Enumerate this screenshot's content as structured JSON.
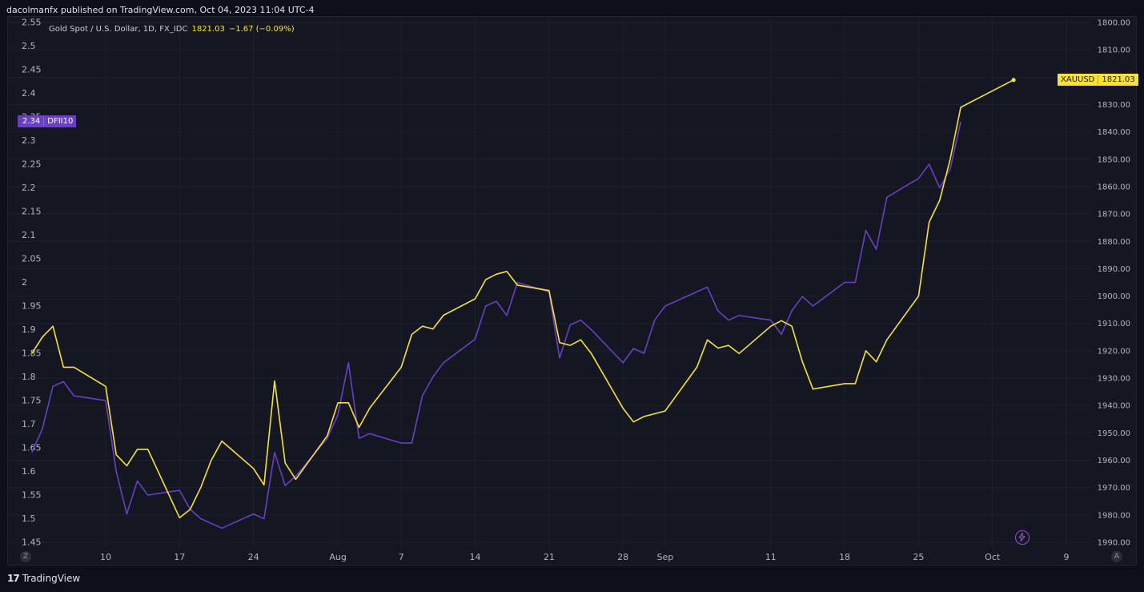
{
  "header": {
    "publisher_text": "dacolmanfx published on TradingView.com, Oct 04, 2023 11:04 UTC-4"
  },
  "legend": {
    "symbol_text": "Gold Spot / U.S. Dollar, 1D, FX_IDC",
    "price": "1821.03",
    "change": "−1.67 (−0.09%)"
  },
  "tags": {
    "left": {
      "value": "2.34",
      "name": "DFII10"
    },
    "right": {
      "name": "XAUUSD",
      "value": "1821.03"
    }
  },
  "footer": {
    "logo_text": "TradingView"
  },
  "buttons": {
    "zoom_left_label": "Z",
    "auto_scale_label": "A"
  },
  "colors": {
    "background": "#0b0f17",
    "panel": "#141722",
    "grid": "#1c2030",
    "axis_text": "#b2b5be",
    "xauusd": "#f7e13b",
    "dfii10": "#6a3fc2"
  },
  "chart_data": {
    "type": "line",
    "grid": true,
    "legend_placement": "top-left",
    "x_ticks": [
      "10",
      "17",
      "24",
      "Aug",
      "7",
      "14",
      "21",
      "28",
      "Sep",
      "11",
      "18",
      "25",
      "Oct",
      "9"
    ],
    "left_axis": {
      "ticks": [
        "2.55",
        "2.5",
        "2.45",
        "2.4",
        "2.35",
        "2.3",
        "2.25",
        "2.2",
        "2.15",
        "2.1",
        "2.05",
        "2",
        "1.95",
        "1.9",
        "1.85",
        "1.8",
        "1.75",
        "1.7",
        "1.65",
        "1.6",
        "1.55",
        "1.5",
        "1.45"
      ],
      "range": [
        1.45,
        2.55
      ]
    },
    "right_axis": {
      "inverted": true,
      "ticks": [
        "1800.00",
        "1810.00",
        "1820.00",
        "1830.00",
        "1840.00",
        "1850.00",
        "1860.00",
        "1870.00",
        "1880.00",
        "1890.00",
        "1900.00",
        "1910.00",
        "1920.00",
        "1930.00",
        "1940.00",
        "1950.00",
        "1960.00",
        "1970.00",
        "1980.00",
        "1990.00"
      ],
      "range": [
        1800,
        1990
      ]
    },
    "series": [
      {
        "name": "XAUUSD",
        "axis": "right",
        "dates": [
          "2023-07-03",
          "2023-07-04",
          "2023-07-05",
          "2023-07-06",
          "2023-07-07",
          "2023-07-10",
          "2023-07-11",
          "2023-07-12",
          "2023-07-13",
          "2023-07-14",
          "2023-07-17",
          "2023-07-18",
          "2023-07-19",
          "2023-07-20",
          "2023-07-21",
          "2023-07-24",
          "2023-07-25",
          "2023-07-26",
          "2023-07-27",
          "2023-07-28",
          "2023-07-31",
          "2023-08-01",
          "2023-08-02",
          "2023-08-03",
          "2023-08-04",
          "2023-08-07",
          "2023-08-08",
          "2023-08-09",
          "2023-08-10",
          "2023-08-11",
          "2023-08-14",
          "2023-08-15",
          "2023-08-16",
          "2023-08-17",
          "2023-08-18",
          "2023-08-21",
          "2023-08-22",
          "2023-08-23",
          "2023-08-24",
          "2023-08-25",
          "2023-08-28",
          "2023-08-29",
          "2023-08-30",
          "2023-08-31",
          "2023-09-01",
          "2023-09-04",
          "2023-09-05",
          "2023-09-06",
          "2023-09-07",
          "2023-09-08",
          "2023-09-11",
          "2023-09-12",
          "2023-09-13",
          "2023-09-14",
          "2023-09-15",
          "2023-09-18",
          "2023-09-19",
          "2023-09-20",
          "2023-09-21",
          "2023-09-22",
          "2023-09-25",
          "2023-09-26",
          "2023-09-27",
          "2023-09-28",
          "2023-09-29",
          "2023-10-02",
          "2023-10-03",
          "2023-10-04"
        ],
        "values": [
          1921,
          1915,
          1911,
          1926,
          1926,
          1933,
          1958,
          1962,
          1956,
          1956,
          1981,
          1978,
          1970,
          1960,
          1953,
          1963,
          1969,
          1931,
          1961,
          1967,
          1951,
          1939,
          1939,
          1948,
          1941,
          1926,
          1914,
          1911,
          1912,
          1907,
          1901,
          1894,
          1892,
          1891,
          1896,
          1898,
          1917,
          1918,
          1916,
          1921,
          1941,
          1946,
          1944,
          1943,
          1942,
          1926,
          1916,
          1919,
          1918,
          1921,
          1911,
          1909,
          1911,
          1924,
          1934,
          1932,
          1932,
          1920,
          1924,
          1916,
          1900,
          1873,
          1865,
          1850,
          1831,
          1825,
          1823,
          1821.03
        ]
      },
      {
        "name": "DFII10",
        "axis": "left",
        "dates": [
          "2023-07-03",
          "2023-07-04",
          "2023-07-05",
          "2023-07-06",
          "2023-07-07",
          "2023-07-10",
          "2023-07-11",
          "2023-07-12",
          "2023-07-13",
          "2023-07-14",
          "2023-07-17",
          "2023-07-18",
          "2023-07-19",
          "2023-07-20",
          "2023-07-21",
          "2023-07-24",
          "2023-07-25",
          "2023-07-26",
          "2023-07-27",
          "2023-07-28",
          "2023-07-31",
          "2023-08-01",
          "2023-08-02",
          "2023-08-03",
          "2023-08-04",
          "2023-08-07",
          "2023-08-08",
          "2023-08-09",
          "2023-08-10",
          "2023-08-11",
          "2023-08-14",
          "2023-08-15",
          "2023-08-16",
          "2023-08-17",
          "2023-08-18",
          "2023-08-21",
          "2023-08-22",
          "2023-08-23",
          "2023-08-24",
          "2023-08-25",
          "2023-08-28",
          "2023-08-29",
          "2023-08-30",
          "2023-08-31",
          "2023-09-01",
          "2023-09-05",
          "2023-09-06",
          "2023-09-07",
          "2023-09-08",
          "2023-09-11",
          "2023-09-12",
          "2023-09-13",
          "2023-09-14",
          "2023-09-15",
          "2023-09-18",
          "2023-09-19",
          "2023-09-20",
          "2023-09-21",
          "2023-09-22",
          "2023-09-25",
          "2023-09-26",
          "2023-09-27",
          "2023-09-28",
          "2023-09-29",
          "2023-10-02"
        ],
        "values": [
          1.64,
          1.69,
          1.78,
          1.79,
          1.76,
          1.75,
          1.6,
          1.51,
          1.58,
          1.55,
          1.56,
          1.52,
          1.5,
          1.49,
          1.48,
          1.51,
          1.5,
          1.64,
          1.57,
          1.59,
          1.67,
          1.72,
          1.83,
          1.67,
          1.68,
          1.66,
          1.66,
          1.76,
          1.8,
          1.83,
          1.88,
          1.95,
          1.96,
          1.93,
          2.0,
          1.98,
          1.84,
          1.91,
          1.92,
          1.9,
          1.83,
          1.86,
          1.85,
          1.92,
          1.95,
          1.99,
          1.94,
          1.92,
          1.93,
          1.92,
          1.89,
          1.94,
          1.97,
          1.95,
          2.0,
          2.0,
          2.11,
          2.07,
          2.18,
          2.22,
          2.25,
          2.2,
          2.24,
          2.34
        ]
      }
    ]
  }
}
